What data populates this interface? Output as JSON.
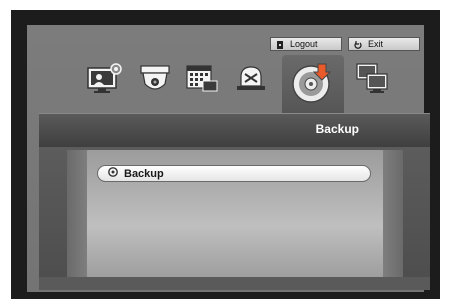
{
  "toolbar": {
    "logout_label": "Logout",
    "exit_label": "Exit"
  },
  "menu_icons": [
    "monitor-settings-icon",
    "camera-dome-icon",
    "record-schedule-icon",
    "alarm-icon",
    "backup-icon",
    "network-icon"
  ],
  "page_title": "Backup",
  "menu": {
    "items": [
      {
        "label": "Backup",
        "icon": "backup-small-icon"
      }
    ]
  },
  "colors": {
    "panel": "#7c7c7c",
    "title_bar": "#4a4a4a",
    "accent_disc": "#e85a2a"
  }
}
